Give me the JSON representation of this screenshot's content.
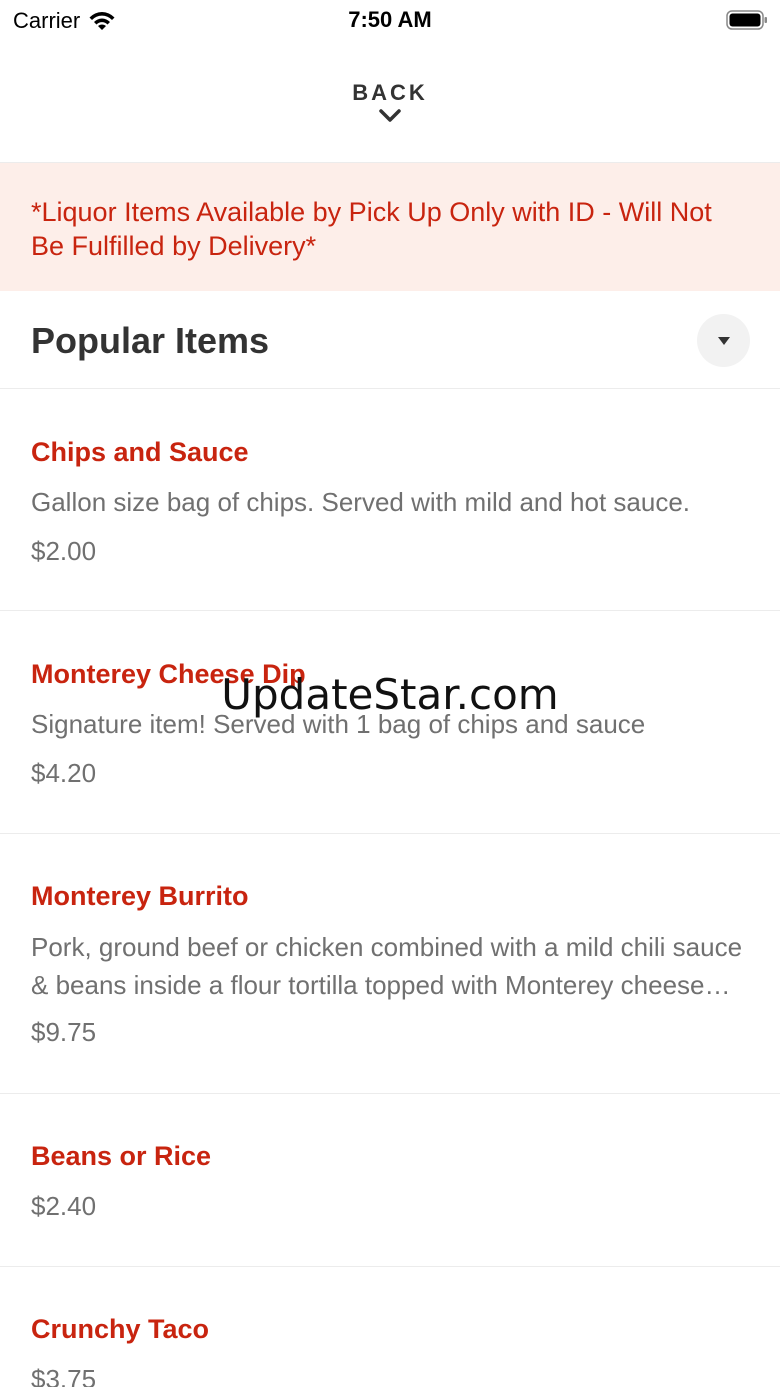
{
  "status_bar": {
    "carrier": "Carrier",
    "time": "7:50 AM"
  },
  "nav": {
    "back_label": "BACK"
  },
  "notice": {
    "text": "*Liquor Items Available by Pick Up Only with ID - Will Not Be Fulfilled by Delivery*"
  },
  "section": {
    "title": "Popular Items"
  },
  "items": [
    {
      "name": "Chips and Sauce",
      "description": "Gallon size bag of chips. Served with mild and hot sauce.",
      "price": "$2.00"
    },
    {
      "name": "Monterey Cheese Dip",
      "description": "Signature item!  Served with 1 bag of chips  and sauce",
      "price": "$4.20"
    },
    {
      "name": "Monterey Burrito",
      "description": "Pork, ground beef or chicken combined with a mild chili sauce & beans inside a flour tortilla topped with Monterey cheese dip",
      "price": "$9.75"
    },
    {
      "name": "Beans or Rice",
      "price": "$2.40"
    },
    {
      "name": "Crunchy Taco",
      "price": "$3.75"
    }
  ],
  "watermark": "UpdateStar.com",
  "colors": {
    "accent": "#c8240f",
    "notice_bg": "#fdeee9",
    "muted_text": "#707070",
    "divider": "#ececec"
  }
}
